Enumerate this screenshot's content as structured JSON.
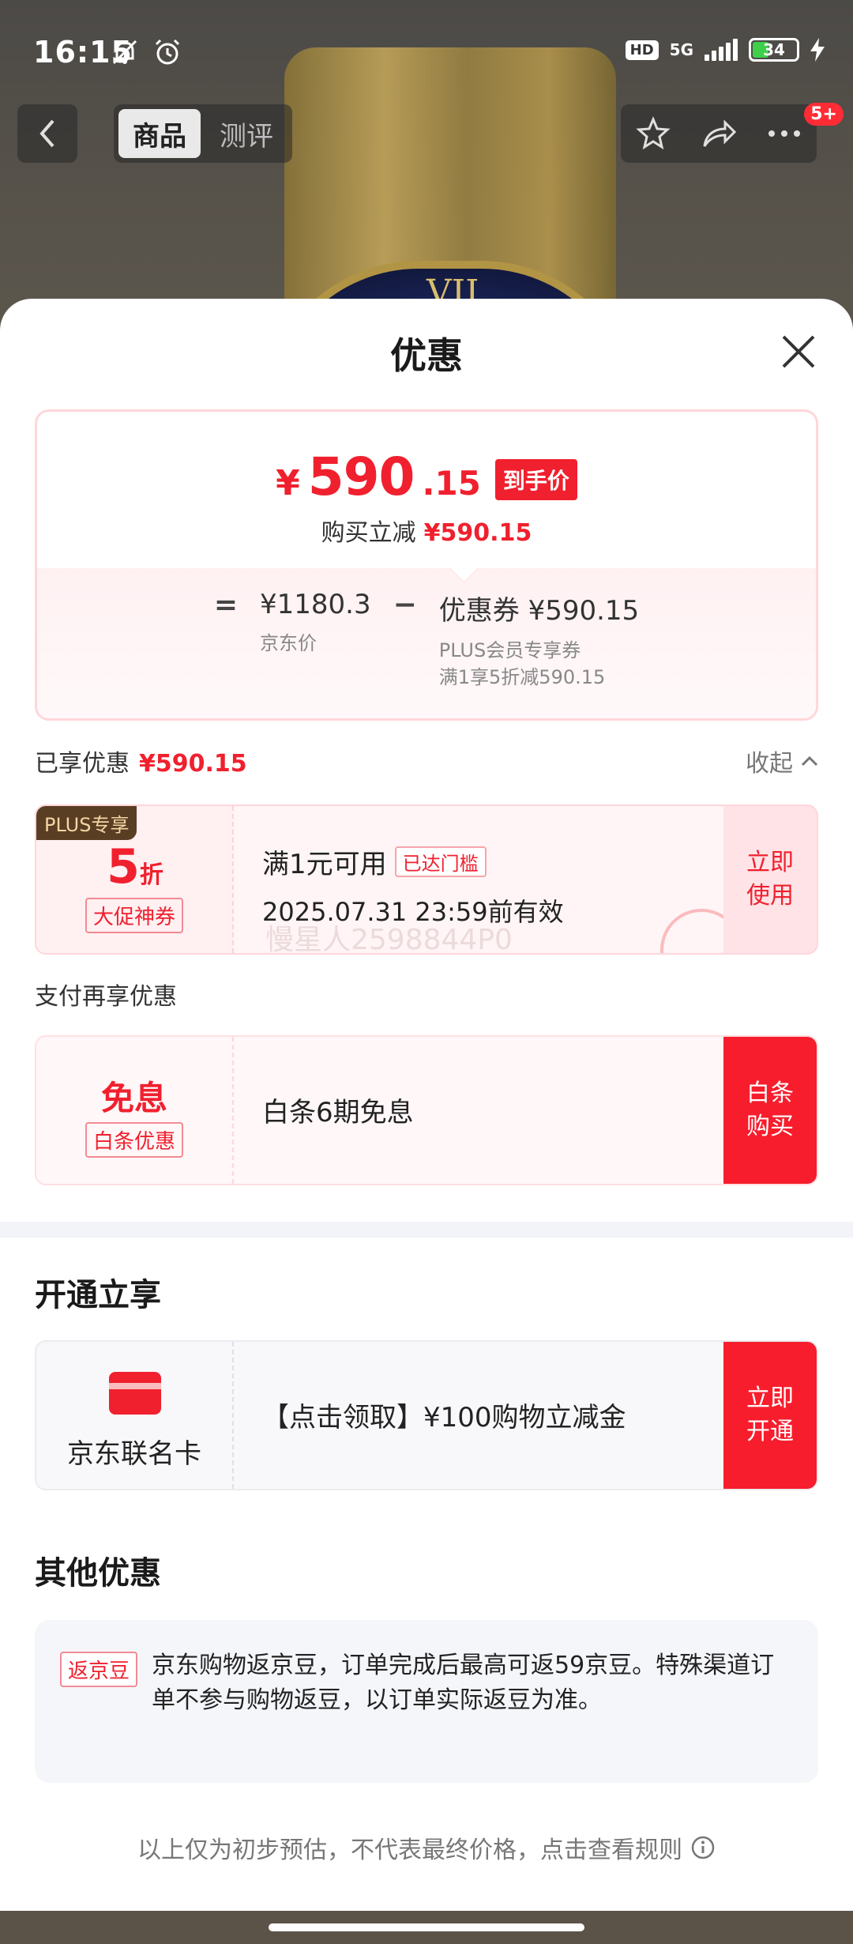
{
  "status_bar": {
    "time": "16:15",
    "hd": "HD",
    "network": "5G",
    "battery": "34"
  },
  "nav": {
    "tabs": [
      {
        "label": "商品",
        "active": true
      },
      {
        "label": "测评",
        "active": false
      }
    ],
    "badge": "5+"
  },
  "background": {
    "numeral": "VII"
  },
  "sheet": {
    "title": "优惠"
  },
  "price": {
    "currency": "¥",
    "integer": "590",
    "decimal": ".15",
    "tag": "到手价",
    "sub_label": "购买立减",
    "sub_value": "¥590.15",
    "eq": "=",
    "jd_price": "¥1180.3",
    "jd_price_label": "京东价",
    "minus": "−",
    "coupon": "优惠券 ¥590.15",
    "coupon_note_1": "PLUS会员专享券",
    "coupon_note_2": "满1享5折减590.15"
  },
  "enjoyed": {
    "label": "已享优惠",
    "value": "¥590.15",
    "collapse": "收起"
  },
  "coupon": {
    "plus_tag": "PLUS专享",
    "discount_num": "5",
    "discount_unit": "折",
    "promo_tag": "大促神券",
    "title": "满1元可用",
    "reached": "已达门槛",
    "date": "2025.07.31 23:59前有效",
    "watermark": "慢星人2598844P0",
    "button": "立即使用"
  },
  "pay": {
    "section_label": "支付再享优惠",
    "big": "免息",
    "tag": "白条优惠",
    "text": "白条6期免息",
    "button": "白条购买"
  },
  "open": {
    "section_title": "开通立享",
    "card_name": "京东联名卡",
    "text": "【点击领取】¥100购物立减金",
    "button": "立即开通"
  },
  "other": {
    "section_title": "其他优惠",
    "tag": "返京豆",
    "text": "京东购物返京豆，订单完成后最高可返59京豆。特殊渠道订单不参与购物返豆，以订单实际返豆为准。"
  },
  "footnote": "以上仅为初步预估，不代表最终价格，点击查看规则",
  "colors": {
    "accent": "#f0202e",
    "button_red": "#f71d2c"
  }
}
